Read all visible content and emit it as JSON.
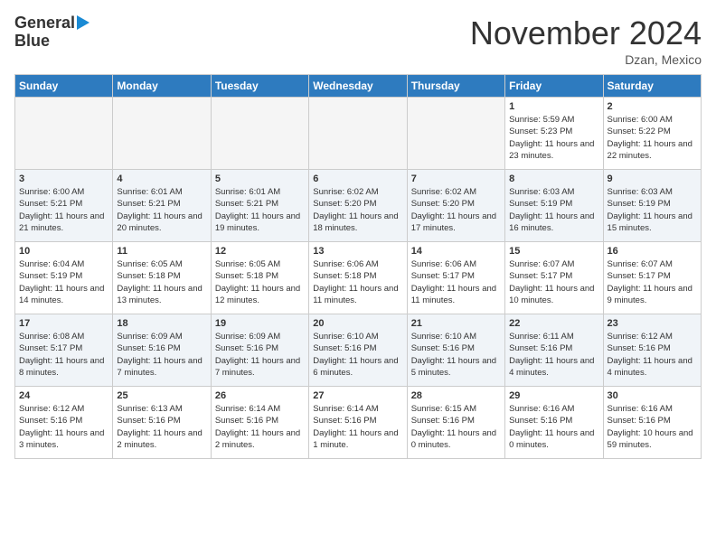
{
  "header": {
    "logo_line1": "General",
    "logo_line2": "Blue",
    "month_title": "November 2024",
    "location": "Dzan, Mexico"
  },
  "days_of_week": [
    "Sunday",
    "Monday",
    "Tuesday",
    "Wednesday",
    "Thursday",
    "Friday",
    "Saturday"
  ],
  "weeks": [
    [
      {
        "day": "",
        "empty": true
      },
      {
        "day": "",
        "empty": true
      },
      {
        "day": "",
        "empty": true
      },
      {
        "day": "",
        "empty": true
      },
      {
        "day": "",
        "empty": true
      },
      {
        "day": "1",
        "sunrise": "Sunrise: 5:59 AM",
        "sunset": "Sunset: 5:23 PM",
        "daylight": "Daylight: 11 hours and 23 minutes."
      },
      {
        "day": "2",
        "sunrise": "Sunrise: 6:00 AM",
        "sunset": "Sunset: 5:22 PM",
        "daylight": "Daylight: 11 hours and 22 minutes."
      }
    ],
    [
      {
        "day": "3",
        "sunrise": "Sunrise: 6:00 AM",
        "sunset": "Sunset: 5:21 PM",
        "daylight": "Daylight: 11 hours and 21 minutes."
      },
      {
        "day": "4",
        "sunrise": "Sunrise: 6:01 AM",
        "sunset": "Sunset: 5:21 PM",
        "daylight": "Daylight: 11 hours and 20 minutes."
      },
      {
        "day": "5",
        "sunrise": "Sunrise: 6:01 AM",
        "sunset": "Sunset: 5:21 PM",
        "daylight": "Daylight: 11 hours and 19 minutes."
      },
      {
        "day": "6",
        "sunrise": "Sunrise: 6:02 AM",
        "sunset": "Sunset: 5:20 PM",
        "daylight": "Daylight: 11 hours and 18 minutes."
      },
      {
        "day": "7",
        "sunrise": "Sunrise: 6:02 AM",
        "sunset": "Sunset: 5:20 PM",
        "daylight": "Daylight: 11 hours and 17 minutes."
      },
      {
        "day": "8",
        "sunrise": "Sunrise: 6:03 AM",
        "sunset": "Sunset: 5:19 PM",
        "daylight": "Daylight: 11 hours and 16 minutes."
      },
      {
        "day": "9",
        "sunrise": "Sunrise: 6:03 AM",
        "sunset": "Sunset: 5:19 PM",
        "daylight": "Daylight: 11 hours and 15 minutes."
      }
    ],
    [
      {
        "day": "10",
        "sunrise": "Sunrise: 6:04 AM",
        "sunset": "Sunset: 5:19 PM",
        "daylight": "Daylight: 11 hours and 14 minutes."
      },
      {
        "day": "11",
        "sunrise": "Sunrise: 6:05 AM",
        "sunset": "Sunset: 5:18 PM",
        "daylight": "Daylight: 11 hours and 13 minutes."
      },
      {
        "day": "12",
        "sunrise": "Sunrise: 6:05 AM",
        "sunset": "Sunset: 5:18 PM",
        "daylight": "Daylight: 11 hours and 12 minutes."
      },
      {
        "day": "13",
        "sunrise": "Sunrise: 6:06 AM",
        "sunset": "Sunset: 5:18 PM",
        "daylight": "Daylight: 11 hours and 11 minutes."
      },
      {
        "day": "14",
        "sunrise": "Sunrise: 6:06 AM",
        "sunset": "Sunset: 5:17 PM",
        "daylight": "Daylight: 11 hours and 11 minutes."
      },
      {
        "day": "15",
        "sunrise": "Sunrise: 6:07 AM",
        "sunset": "Sunset: 5:17 PM",
        "daylight": "Daylight: 11 hours and 10 minutes."
      },
      {
        "day": "16",
        "sunrise": "Sunrise: 6:07 AM",
        "sunset": "Sunset: 5:17 PM",
        "daylight": "Daylight: 11 hours and 9 minutes."
      }
    ],
    [
      {
        "day": "17",
        "sunrise": "Sunrise: 6:08 AM",
        "sunset": "Sunset: 5:17 PM",
        "daylight": "Daylight: 11 hours and 8 minutes."
      },
      {
        "day": "18",
        "sunrise": "Sunrise: 6:09 AM",
        "sunset": "Sunset: 5:16 PM",
        "daylight": "Daylight: 11 hours and 7 minutes."
      },
      {
        "day": "19",
        "sunrise": "Sunrise: 6:09 AM",
        "sunset": "Sunset: 5:16 PM",
        "daylight": "Daylight: 11 hours and 7 minutes."
      },
      {
        "day": "20",
        "sunrise": "Sunrise: 6:10 AM",
        "sunset": "Sunset: 5:16 PM",
        "daylight": "Daylight: 11 hours and 6 minutes."
      },
      {
        "day": "21",
        "sunrise": "Sunrise: 6:10 AM",
        "sunset": "Sunset: 5:16 PM",
        "daylight": "Daylight: 11 hours and 5 minutes."
      },
      {
        "day": "22",
        "sunrise": "Sunrise: 6:11 AM",
        "sunset": "Sunset: 5:16 PM",
        "daylight": "Daylight: 11 hours and 4 minutes."
      },
      {
        "day": "23",
        "sunrise": "Sunrise: 6:12 AM",
        "sunset": "Sunset: 5:16 PM",
        "daylight": "Daylight: 11 hours and 4 minutes."
      }
    ],
    [
      {
        "day": "24",
        "sunrise": "Sunrise: 6:12 AM",
        "sunset": "Sunset: 5:16 PM",
        "daylight": "Daylight: 11 hours and 3 minutes."
      },
      {
        "day": "25",
        "sunrise": "Sunrise: 6:13 AM",
        "sunset": "Sunset: 5:16 PM",
        "daylight": "Daylight: 11 hours and 2 minutes."
      },
      {
        "day": "26",
        "sunrise": "Sunrise: 6:14 AM",
        "sunset": "Sunset: 5:16 PM",
        "daylight": "Daylight: 11 hours and 2 minutes."
      },
      {
        "day": "27",
        "sunrise": "Sunrise: 6:14 AM",
        "sunset": "Sunset: 5:16 PM",
        "daylight": "Daylight: 11 hours and 1 minute."
      },
      {
        "day": "28",
        "sunrise": "Sunrise: 6:15 AM",
        "sunset": "Sunset: 5:16 PM",
        "daylight": "Daylight: 11 hours and 0 minutes."
      },
      {
        "day": "29",
        "sunrise": "Sunrise: 6:16 AM",
        "sunset": "Sunset: 5:16 PM",
        "daylight": "Daylight: 11 hours and 0 minutes."
      },
      {
        "day": "30",
        "sunrise": "Sunrise: 6:16 AM",
        "sunset": "Sunset: 5:16 PM",
        "daylight": "Daylight: 10 hours and 59 minutes."
      }
    ]
  ]
}
